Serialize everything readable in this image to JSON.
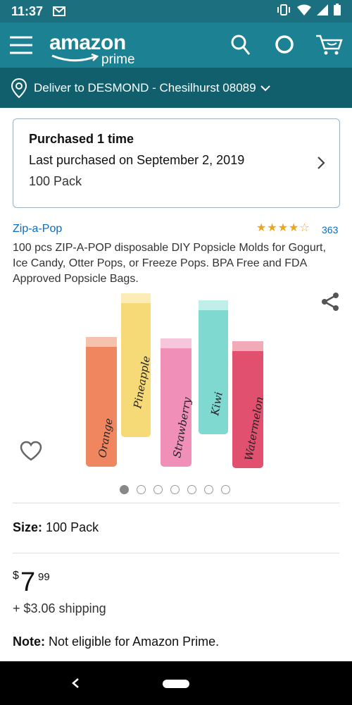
{
  "status_bar": {
    "time": "11:37"
  },
  "app_bar": {
    "logo_text": "amazon",
    "logo_sub": "prime",
    "icons": [
      "menu-icon",
      "search-icon",
      "alexa-icon",
      "cart-icon"
    ]
  },
  "deliver": {
    "text": "Deliver to DESMOND - Chesilhurst 08089"
  },
  "purchased": {
    "title": "Purchased 1 time",
    "last": "Last purchased on September 2, 2019",
    "pack": "100 Pack"
  },
  "product": {
    "brand": "Zip-a-Pop",
    "rating": 4,
    "rating_max": 5,
    "rating_count": "363",
    "title": "100 pcs ZIP-A-POP disposable DIY Popsicle Molds for Gogurt, Ice Candy, Otter Pops, or Freeze Pops. BPA Free and FDA Approved Popsicle Bags.",
    "image_labels": [
      "Orange",
      "Pineapple",
      "Strawberry",
      "Kiwi",
      "Watermelon"
    ],
    "image_dots": 7,
    "image_active_dot": 0,
    "size_label": "Size:",
    "size_value": "100 Pack",
    "price_symbol": "$",
    "price_whole": "7",
    "price_fraction": "99",
    "shipping": "+ $3.06 shipping",
    "note_label": "Note:",
    "note_text": "Not eligible for Amazon Prime."
  },
  "colors": {
    "app_bar": "#1b8193",
    "deliver_bar": "#115f6d",
    "link": "#0a6cc2",
    "star": "#f0a31b"
  }
}
